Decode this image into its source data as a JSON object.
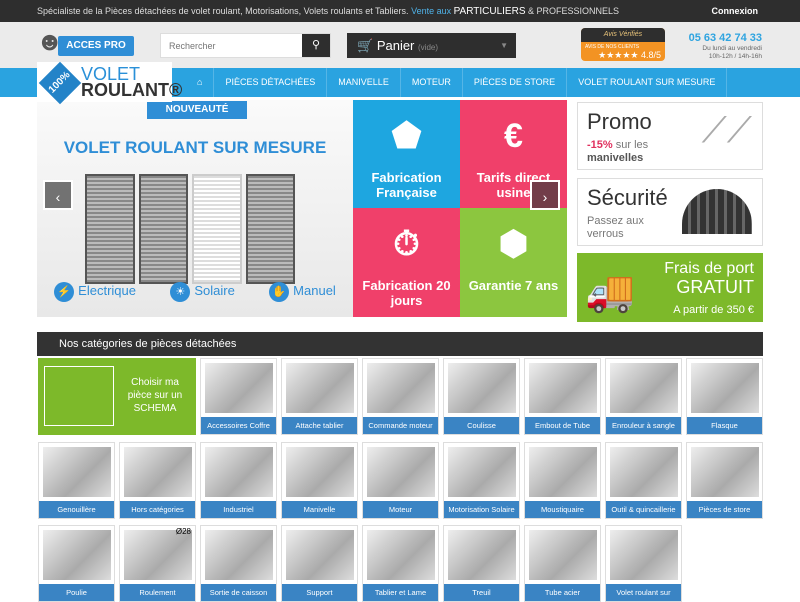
{
  "topbar": {
    "message": "Spécialiste de la Pièces détachées de volet roulant, Motorisations, Volets roulants et Tabliers.",
    "vente": "Vente aux",
    "particuliers": "PARTICULIERS",
    "pros": "& PROFESSIONNELS",
    "login": "Connexion"
  },
  "header": {
    "pro_label": "ACCES PRO",
    "search_placeholder": "Rechercher",
    "cart_label": "Panier",
    "cart_status": "(vide)",
    "reviews_brand": "Avis Vérifiés",
    "reviews_caption": "AVIS DE NOS CLIENTS",
    "reviews_rating": "★★★★★ 4.8/5",
    "phone": "05 63 42 74 33",
    "hours_line1": "Du lundi au vendredi",
    "hours_line2": "10h-12h / 14h-16h"
  },
  "logo": {
    "badge": "100%",
    "line1": "VOLET",
    "line2": "ROULANT®"
  },
  "nav": {
    "items": [
      "PIÈCES DÉTACHÉES",
      "MANIVELLE",
      "MOTEUR",
      "PIÈCES DE STORE",
      "VOLET ROULANT SUR MESURE"
    ]
  },
  "hero": {
    "badge": "NOUVEAUTÉ",
    "title": "VOLET ROULANT SUR MESURE",
    "features": [
      "Electrique",
      "Solaire",
      "Manuel"
    ]
  },
  "tiles": [
    {
      "label": "Fabrication Française",
      "color": "#1ea6e0"
    },
    {
      "label": "Tarifs direct usine",
      "color": "#f0406a"
    },
    {
      "label": "Fabrication 20 jours",
      "color": "#f0406a"
    },
    {
      "label": "Garantie 7 ans",
      "color": "#8cc63f"
    }
  ],
  "banners": {
    "promo_title": "Promo",
    "promo_pct": "-15%",
    "promo_text": "sur les",
    "promo_bold": "manivelles",
    "secu_title": "Sécurité",
    "secu_text": "Passez aux verrous",
    "ship_line1": "Frais de port",
    "ship_line2": "GRATUIT",
    "ship_line3": "A partir de 350 €"
  },
  "categories": {
    "heading": "Nos catégories de pièces détachées",
    "schema_label": "Choisir ma pièce sur un SCHEMA",
    "items": [
      "Accessoires Coffre",
      "Attache tablier",
      "Commande moteur",
      "Coulisse",
      "Embout de Tube",
      "Enrouleur à sangle",
      "Flasque",
      "Genouillère",
      "Hors catégories",
      "Industriel",
      "Manivelle",
      "Moteur",
      "Motorisation Solaire",
      "Moustiquaire",
      "Outil & quincaillerie",
      "Pièces de store",
      "Poulie",
      "Roulement",
      "Sortie de caisson",
      "Support",
      "Tablier et Lame",
      "Treuil",
      "Tube acier",
      "Volet roulant sur"
    ],
    "roulement_tag": "Ø28"
  }
}
